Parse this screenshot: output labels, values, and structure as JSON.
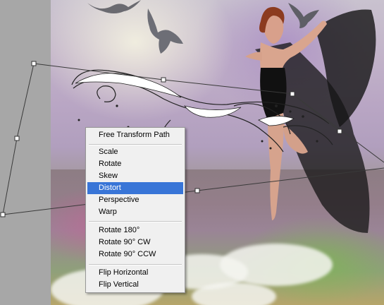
{
  "context_menu": {
    "groups": [
      [
        {
          "label": "Free Transform Path"
        }
      ],
      [
        {
          "label": "Scale"
        },
        {
          "label": "Rotate"
        },
        {
          "label": "Skew"
        },
        {
          "label": "Distort",
          "selected": true
        },
        {
          "label": "Perspective"
        },
        {
          "label": "Warp"
        }
      ],
      [
        {
          "label": "Rotate 180°"
        },
        {
          "label": "Rotate 90° CW"
        },
        {
          "label": "Rotate 90° CCW"
        }
      ],
      [
        {
          "label": "Flip Horizontal"
        },
        {
          "label": "Flip Vertical"
        }
      ]
    ],
    "highlight_color": "#3875d7"
  },
  "canvas": {
    "pasteboard_color": "#a7a7a7"
  },
  "icons": [
    "bird-icon",
    "transform-handle-icon"
  ]
}
